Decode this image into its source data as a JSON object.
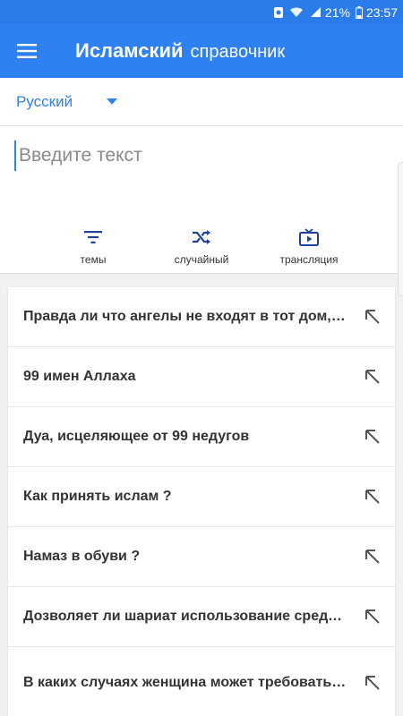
{
  "status_bar": {
    "battery_percent": "21%",
    "time": "23:57",
    "icons": [
      "notification-icon",
      "wifi-icon",
      "signal-icon",
      "battery-icon"
    ]
  },
  "app_bar": {
    "title_bold": "Исламский",
    "title_light": "справочник",
    "menu_icon": "hamburger-menu-icon"
  },
  "language": {
    "selected": "Русский"
  },
  "search": {
    "placeholder": "Введите текст",
    "value": ""
  },
  "actions": [
    {
      "label": "темы",
      "icon": "filter-icon"
    },
    {
      "label": "случайный",
      "icon": "shuffle-icon"
    },
    {
      "label": "трансляция",
      "icon": "live-tv-icon"
    }
  ],
  "list_items": [
    "Правда ли что ангелы не входят в тот дом, где есть собака?",
    "99 имен Аллаха",
    "Дуа, исцеляющее от 99 недугов",
    "Как принять ислам ?",
    "Намаз в обуви ?",
    "Дозволяет ли шариат использование средств",
    "В каких случаях женщина может требовать развод"
  ],
  "colors": {
    "primary": "#2f80f0",
    "status_bar": "#2b7bea",
    "icon_dark_blue": "#1f3f9b",
    "text_dark": "#333333"
  }
}
